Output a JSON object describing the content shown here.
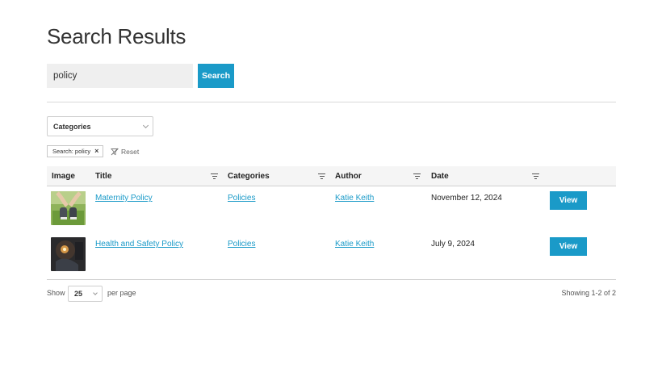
{
  "page": {
    "title": "Search Results"
  },
  "search": {
    "value": "policy",
    "button_label": "Search"
  },
  "filters": {
    "categories_label": "Categories",
    "active_chip": "Search: policy",
    "chip_remove": "×",
    "reset_label": "Reset"
  },
  "table": {
    "columns": [
      "Image",
      "Title",
      "Categories",
      "Author",
      "Date"
    ],
    "rows": [
      {
        "title": "Maternity Policy",
        "category": "Policies",
        "author": "Katie Keith",
        "date": "November 12, 2024",
        "action": "View",
        "image_icon": "baby-shoes-photo"
      },
      {
        "title": "Health and Safety Policy",
        "category": "Policies",
        "author": "Katie Keith",
        "date": "July 9, 2024",
        "action": "View",
        "image_icon": "dark-candle-photo"
      }
    ]
  },
  "pagination": {
    "show_label": "Show",
    "per_page_value": "25",
    "per_page_label": "per page",
    "showing_text": "Showing 1-2 of 2"
  },
  "colors": {
    "accent": "#1a9ac8",
    "input_bg": "#efefef",
    "header_bg": "#f5f5f5"
  }
}
